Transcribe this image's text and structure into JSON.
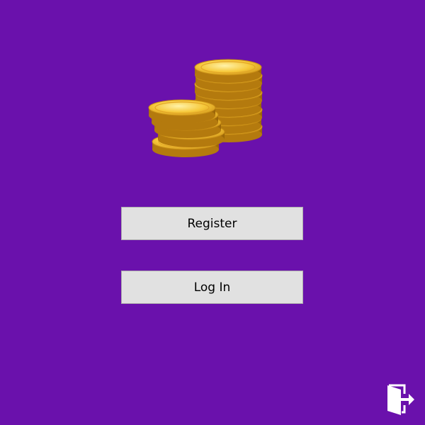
{
  "colors": {
    "background": "#6a11ac",
    "button_face": "#e1e1e1",
    "button_border": "#adadad",
    "coin_gold": "#f2b623"
  },
  "logo": {
    "icon": "coin-stack-icon"
  },
  "buttons": {
    "register_label": "Register",
    "login_label": "Log In"
  },
  "exit": {
    "icon": "exit-door-icon"
  }
}
